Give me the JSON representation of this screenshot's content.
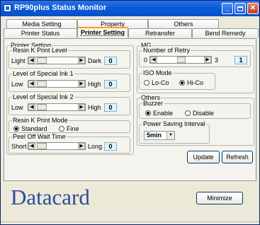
{
  "window": {
    "title": "RP90plus Status Monitor",
    "controls": {
      "minimize": "_",
      "maximize": "",
      "close": "✕"
    }
  },
  "tabs": {
    "row1": [
      "Media Setting",
      "Property",
      "Others"
    ],
    "row2": [
      "Printer Status",
      "Printer Setting",
      "Retransfer",
      "Bend Remedy"
    ],
    "active": "Printer Setting"
  },
  "printer_setting": {
    "legend": "Printer Setting",
    "resin_k": {
      "label": "Resin K Print Level",
      "low": "Light",
      "high": "Dark",
      "value": "0"
    },
    "ink1": {
      "label": "Level of Special Ink 1",
      "low": "Low",
      "high": "High",
      "value": "0"
    },
    "ink2": {
      "label": "Level of Special Ink 2",
      "low": "Low",
      "high": "High",
      "value": "0"
    },
    "resin_mode": {
      "label": "Resin K Print Mode",
      "options": [
        "Standard",
        "Fine"
      ],
      "selected": "Standard"
    },
    "peel": {
      "label": "Peel Off Wait Time",
      "low": "Short",
      "high": "Long",
      "value": "0"
    }
  },
  "mg": {
    "legend": "MG",
    "retry": {
      "label": "Number of Retry",
      "low": "0",
      "high": "3",
      "value": "1"
    },
    "iso": {
      "label": "ISO Mode",
      "options": [
        "Lo-Co",
        "Hi-Co"
      ],
      "selected": "Hi-Co"
    }
  },
  "others": {
    "legend": "Others",
    "buzzer": {
      "label": "Buzzer",
      "options": [
        "Enable",
        "Disable"
      ],
      "selected": "Enable"
    },
    "power": {
      "label": "Power Saving Interval",
      "value": "5min"
    }
  },
  "buttons": {
    "update": "Update",
    "refresh": "Refresh",
    "minimize": "Minimize"
  },
  "brand": {
    "logo": "Datacard",
    "logo_color": "#2a4d9a"
  },
  "colors": {
    "titlebar": "#0a5bd8",
    "active_tab_accent": "#f0a51b",
    "value_box": "#e0f4f8"
  }
}
